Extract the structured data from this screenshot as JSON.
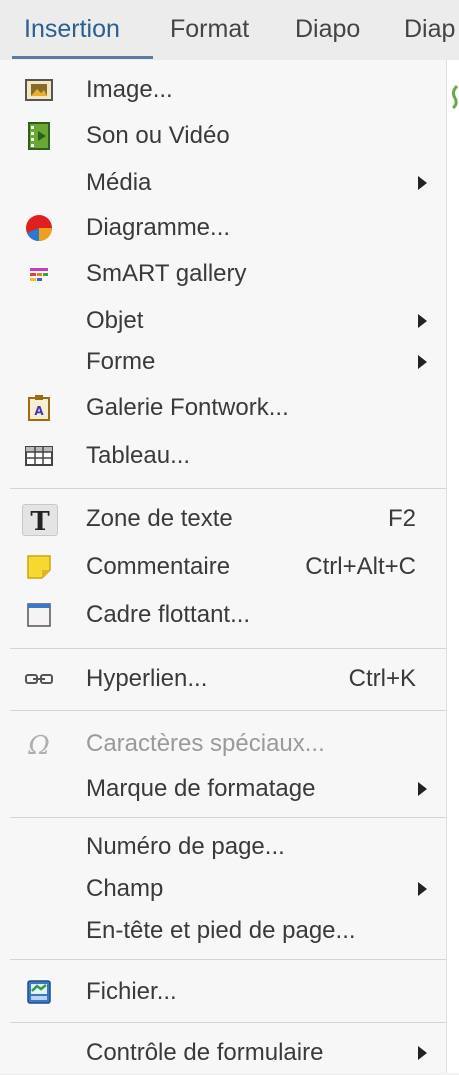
{
  "menubar": {
    "items": [
      {
        "label": "Insertion"
      },
      {
        "label": "Format"
      },
      {
        "label": "Diapo"
      },
      {
        "label": "Diap"
      }
    ]
  },
  "menu": {
    "items": [
      {
        "label": "Image...",
        "icon": "image-icon"
      },
      {
        "label": "Son ou Vidéo",
        "icon": "film-icon"
      },
      {
        "label": "Média",
        "submenu": true
      },
      {
        "label": "Diagramme...",
        "icon": "pie-chart-icon"
      },
      {
        "label": "SmART gallery",
        "icon": "smart-gallery-icon"
      },
      {
        "label": "Objet",
        "submenu": true
      },
      {
        "label": "Forme",
        "submenu": true
      },
      {
        "label": "Galerie Fontwork...",
        "icon": "fontwork-icon"
      },
      {
        "label": "Tableau...",
        "icon": "table-icon"
      },
      {
        "label": "Zone de texte",
        "shortcut": "F2",
        "icon": "text-box-icon"
      },
      {
        "label": "Commentaire",
        "shortcut": "Ctrl+Alt+C",
        "icon": "sticky-note-icon"
      },
      {
        "label": "Cadre flottant...",
        "icon": "frame-icon"
      },
      {
        "label": "Hyperlien...",
        "shortcut": "Ctrl+K",
        "icon": "hyperlink-icon"
      },
      {
        "label": "Caractères spéciaux...",
        "icon": "omega-icon",
        "disabled": true
      },
      {
        "label": "Marque de formatage",
        "submenu": true
      },
      {
        "label": "Numéro de page..."
      },
      {
        "label": "Champ",
        "submenu": true
      },
      {
        "label": "En-tête et pied de page..."
      },
      {
        "label": "Fichier...",
        "icon": "file-icon"
      },
      {
        "label": "Contrôle de formulaire",
        "submenu": true
      }
    ]
  }
}
